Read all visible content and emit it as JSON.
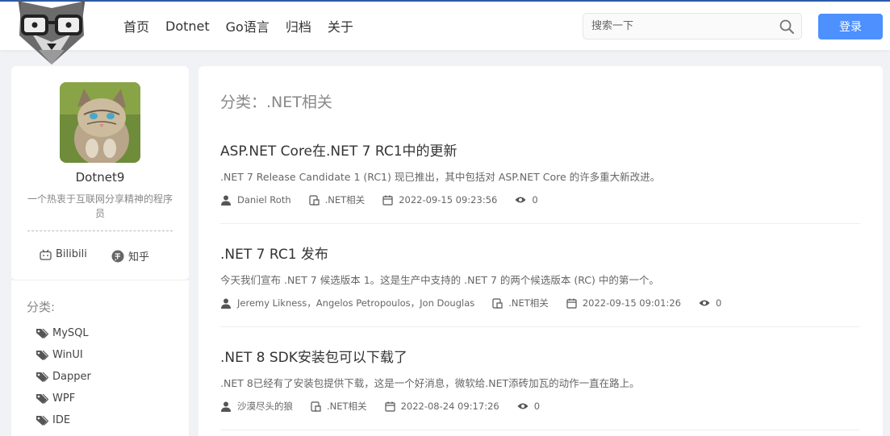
{
  "header": {
    "nav": [
      "首页",
      "Dotnet",
      "Go语言",
      "归档",
      "关于"
    ],
    "search_placeholder": "搜索一下",
    "login_label": "登录"
  },
  "profile": {
    "name": "Dotnet9",
    "description": "一个热衷于互联网分享精神的程序员",
    "links": [
      "Bilibili",
      "知乎"
    ]
  },
  "categories": {
    "title": "分类:",
    "items": [
      "MySQL",
      "WinUI",
      "Dapper",
      "WPF",
      "IDE"
    ]
  },
  "main": {
    "page_title": "分类：.NET相关",
    "articles": [
      {
        "title": "ASP.NET Core在.NET 7 RC1中的更新",
        "summary": ".NET 7 Release Candidate 1 (RC1) 现已推出，其中包括对 ASP.NET Core 的许多重大新改进。",
        "author": "Daniel Roth",
        "category": ".NET相关",
        "date": "2022-09-15 09:23:56",
        "views": "0"
      },
      {
        "title": ".NET 7 RC1 发布",
        "summary": "今天我们宣布 .NET 7 候选版本 1。这是生产中支持的 .NET 7 的两个候选版本 (RC) 中的第一个。",
        "author": "Jeremy Likness，Angelos Petropoulos，Jon Douglas",
        "category": ".NET相关",
        "date": "2022-09-15 09:01:26",
        "views": "0"
      },
      {
        "title": ".NET 8 SDK安装包可以下载了",
        "summary": ".NET 8已经有了安装包提供下载，这是一个好消息，微软给.NET添砖加瓦的动作一直在路上。",
        "author": "沙漠尽头的狼",
        "category": ".NET相关",
        "date": "2022-08-24 09:17:26",
        "views": "0"
      }
    ]
  },
  "colors": {
    "accent": "#4d90fe",
    "top_bar": "#2b5bab",
    "background": "#f0f2f5"
  }
}
